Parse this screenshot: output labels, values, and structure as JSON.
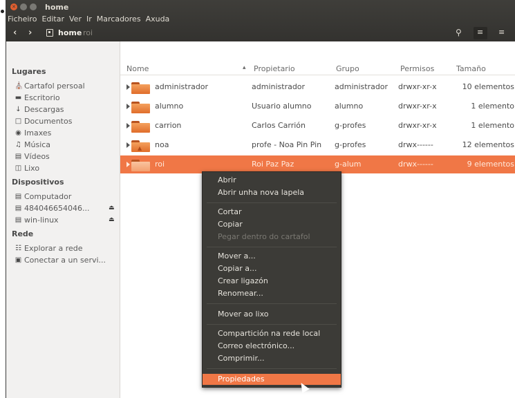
{
  "window": {
    "title": "home"
  },
  "menubar": [
    "Ficheiro",
    "Editar",
    "Ver",
    "Ir",
    "Marcadores",
    "Axuda"
  ],
  "toolbar": {
    "breadcrumb": [
      "home",
      "roi"
    ],
    "back_icon": "back-arrow-icon",
    "forward_icon": "forward-arrow-icon",
    "search_icon": "search-icon",
    "list_view_icon": "list-view-icon",
    "grid_view_icon": "grid-view-icon"
  },
  "sidebar": {
    "sections": [
      {
        "title": "Lugares",
        "items": [
          {
            "label": "Cartafol persoal",
            "icon": "home-icon"
          },
          {
            "label": "Escritorio",
            "icon": "desktop-icon"
          },
          {
            "label": "Descargas",
            "icon": "download-icon"
          },
          {
            "label": "Documentos",
            "icon": "document-icon"
          },
          {
            "label": "Imaxes",
            "icon": "camera-icon"
          },
          {
            "label": "Música",
            "icon": "music-icon"
          },
          {
            "label": "Vídeos",
            "icon": "video-icon"
          },
          {
            "label": "Lixo",
            "icon": "trash-icon"
          }
        ]
      },
      {
        "title": "Dispositivos",
        "items": [
          {
            "label": "Computador",
            "icon": "drive-icon"
          },
          {
            "label": "484046654046...",
            "icon": "drive-icon"
          },
          {
            "label": "win-linux",
            "icon": "drive-icon"
          }
        ]
      },
      {
        "title": "Rede",
        "items": [
          {
            "label": "Explorar a rede",
            "icon": "network-icon"
          },
          {
            "label": "Conectar a un servi...",
            "icon": "server-icon"
          }
        ]
      }
    ]
  },
  "columns": [
    "Nome",
    "Propietario",
    "Grupo",
    "Permisos",
    "Tamaño"
  ],
  "rows": [
    {
      "name": "administrador",
      "owner": "administrador",
      "group": "administrador",
      "perms": "drwxr-xr-x",
      "size": "10 elementos",
      "selected": false
    },
    {
      "name": "alumno",
      "owner": "Usuario alumno",
      "group": "alumno",
      "perms": "drwxr-xr-x",
      "size": "1 elemento",
      "selected": false
    },
    {
      "name": "carrion",
      "owner": "Carlos Carrión",
      "group": "g-profes",
      "perms": "drwxr-xr-x",
      "size": "1 elemento",
      "selected": false
    },
    {
      "name": "noa",
      "owner": "profe - Noa Pin Pin",
      "group": "g-profes",
      "perms": "drwx------",
      "size": "12 elementos",
      "selected": false
    },
    {
      "name": "roi",
      "owner": "Roi Paz Paz",
      "group": "g-alum",
      "perms": "drwx------",
      "size": "9 elementos",
      "selected": true
    }
  ],
  "context_menu": [
    [
      {
        "label": "Abrir"
      },
      {
        "label": "Abrir unha nova lapela"
      }
    ],
    [
      {
        "label": "Cortar"
      },
      {
        "label": "Copiar"
      },
      {
        "label": "Pegar dentro do cartafol",
        "disabled": true
      }
    ],
    [
      {
        "label": "Mover a..."
      },
      {
        "label": "Copiar a..."
      },
      {
        "label": "Crear ligazón"
      },
      {
        "label": "Renomear..."
      }
    ],
    [
      {
        "label": "Mover ao lixo"
      }
    ],
    [
      {
        "label": "Compartición na rede local"
      },
      {
        "label": "Correo electrónico..."
      },
      {
        "label": "Comprimir..."
      }
    ],
    [
      {
        "label": "Propiedades",
        "highlighted": true
      }
    ]
  ],
  "colors": {
    "accent": "#f07746",
    "titlebar": "#3c3b37",
    "sidebar": "#f2f1f0"
  }
}
